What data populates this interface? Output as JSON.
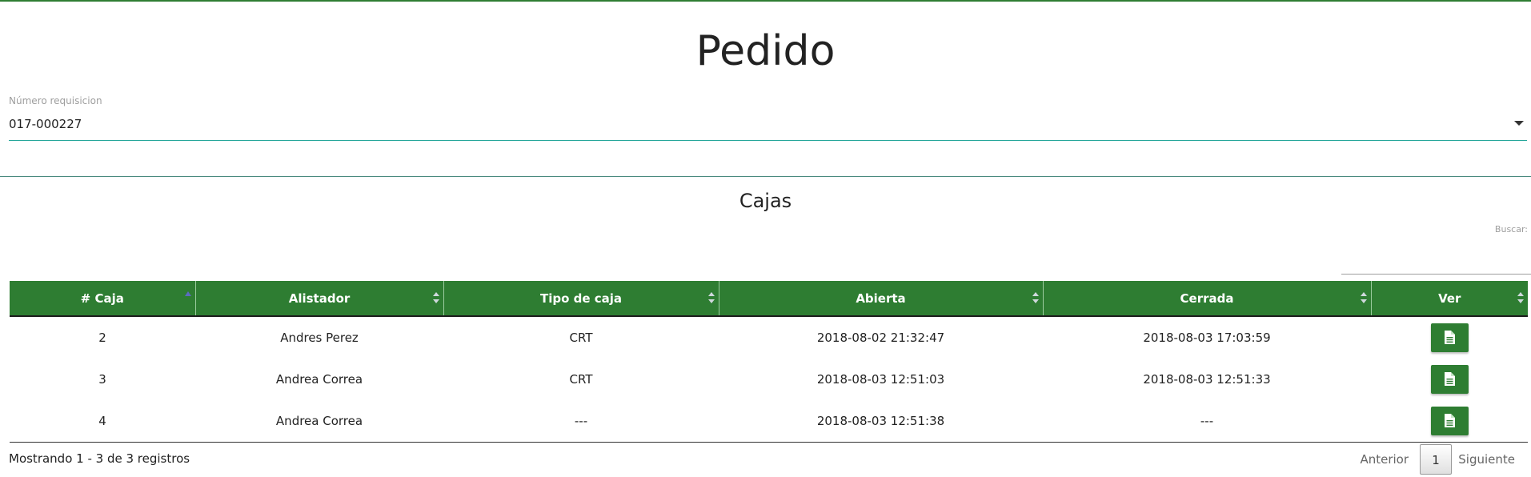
{
  "page": {
    "title": "Pedido"
  },
  "requisition": {
    "label": "Número requisicion",
    "value": "017-000227"
  },
  "boxes": {
    "title": "Cajas",
    "search_label": "Buscar:",
    "search_value": "",
    "columns": [
      "# Caja",
      "Alistador",
      "Tipo de caja",
      "Abierta",
      "Cerrada",
      "Ver"
    ],
    "sorted_column": "# Caja",
    "rows": [
      {
        "caja": "2",
        "alistador": "Andres Perez",
        "tipo": "CRT",
        "abierta": "2018-08-02 21:32:47",
        "cerrada": "2018-08-03 17:03:59"
      },
      {
        "caja": "3",
        "alistador": "Andrea Correa",
        "tipo": "CRT",
        "abierta": "2018-08-03 12:51:03",
        "cerrada": "2018-08-03 12:51:33"
      },
      {
        "caja": "4",
        "alistador": "Andrea Correa",
        "tipo": "---",
        "abierta": "2018-08-03 12:51:38",
        "cerrada": "---"
      }
    ],
    "info": "Mostrando 1 - 3 de 3 registros",
    "pagination": {
      "prev": "Anterior",
      "current": "1",
      "next": "Siguiente"
    }
  },
  "colors": {
    "header_bg": "#2e7d32",
    "accent_line": "#26a69a",
    "top_bar": "#2e7d32"
  },
  "icons": {
    "view": "document-icon",
    "dropdown": "caret-down-icon",
    "sort": "sort-icon"
  }
}
